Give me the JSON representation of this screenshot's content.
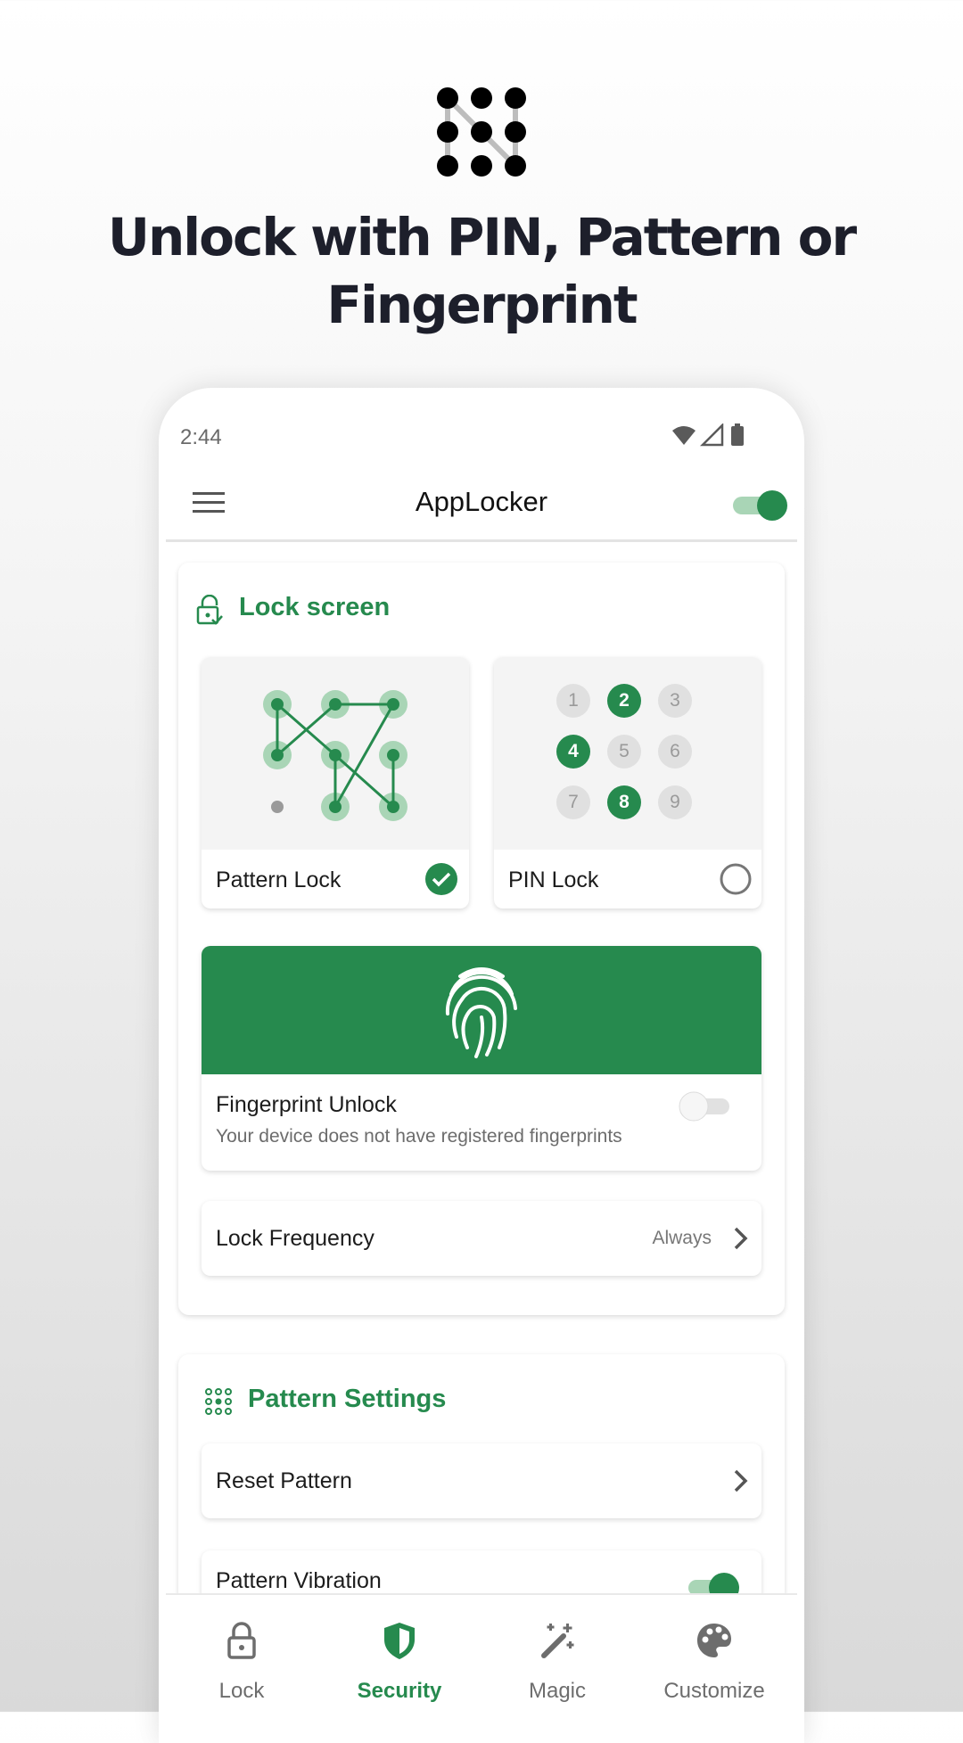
{
  "promo": {
    "headline_line1": "Unlock with PIN, Pattern or",
    "headline_line2": "Fingerprint"
  },
  "status_bar": {
    "time": "2:44"
  },
  "app_bar": {
    "title": "AppLocker",
    "master_toggle_on": true
  },
  "lock_screen": {
    "title": "Lock screen",
    "options": [
      {
        "label": "Pattern Lock",
        "selected": true
      },
      {
        "label": "PIN Lock",
        "selected": false
      }
    ],
    "pin_digits": [
      "1",
      "2",
      "3",
      "4",
      "5",
      "6",
      "7",
      "8",
      "9"
    ],
    "pin_highlighted": [
      "2",
      "4",
      "8"
    ],
    "fingerprint": {
      "title": "Fingerprint Unlock",
      "subtitle": "Your device does not have registered fingerprints",
      "enabled": false
    },
    "frequency": {
      "label": "Lock Frequency",
      "value": "Always"
    }
  },
  "pattern_settings": {
    "title": "Pattern Settings",
    "reset_label": "Reset Pattern",
    "vibration_label": "Pattern Vibration",
    "vibration_on": true
  },
  "bottom_nav": [
    {
      "label": "Lock",
      "icon": "lock-icon",
      "active": false
    },
    {
      "label": "Security",
      "icon": "shield-icon",
      "active": true
    },
    {
      "label": "Magic",
      "icon": "magic-wand-icon",
      "active": false
    },
    {
      "label": "Customize",
      "icon": "palette-icon",
      "active": false
    }
  ],
  "colors": {
    "accent": "#268a4e",
    "accent_light": "#a9d5b6",
    "headline": "#1d1f2b"
  }
}
